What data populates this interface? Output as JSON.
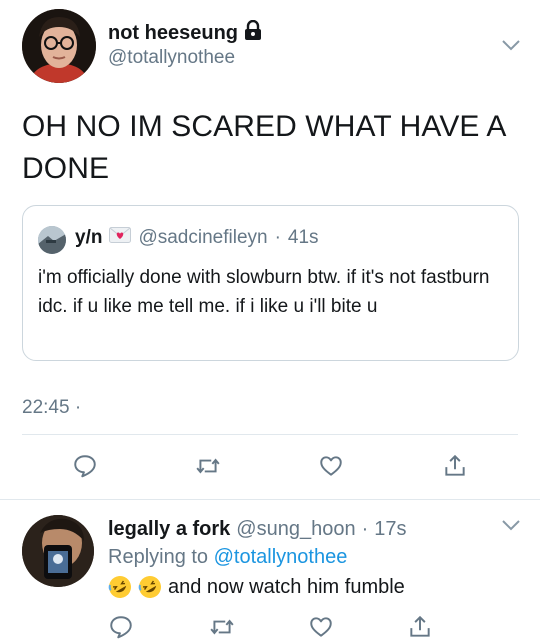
{
  "main_tweet": {
    "display_name": "not heeseung",
    "handle": "@totallynothee",
    "text": "OH NO IM SCARED WHAT HAVE A DONE",
    "time": "22:45",
    "time_separator": "·"
  },
  "quoted_tweet": {
    "display_name": "y/n",
    "handle": "@sadcinefileyn",
    "separator": "·",
    "age": "41s",
    "text": "i'm officially done with slowburn btw. if it's not fastburn idc. if u like me tell me. if i like u i'll bite u"
  },
  "reply_tweet": {
    "display_name": "legally a fork",
    "handle": "@sung_hoon",
    "separator": "·",
    "age": "17s",
    "replying_prefix": "Replying to",
    "replying_handle": "@totallynothee",
    "text": "and now watch him fumble"
  },
  "icons": {
    "reply": "reply-icon",
    "retweet": "retweet-icon",
    "like": "heart-icon",
    "share": "share-icon",
    "protected": "lock-icon",
    "more": "chevron-down-icon"
  },
  "colors": {
    "text": "#14171a",
    "secondary": "#657786",
    "link": "#1b95e0",
    "border": "#e1e8ed"
  }
}
